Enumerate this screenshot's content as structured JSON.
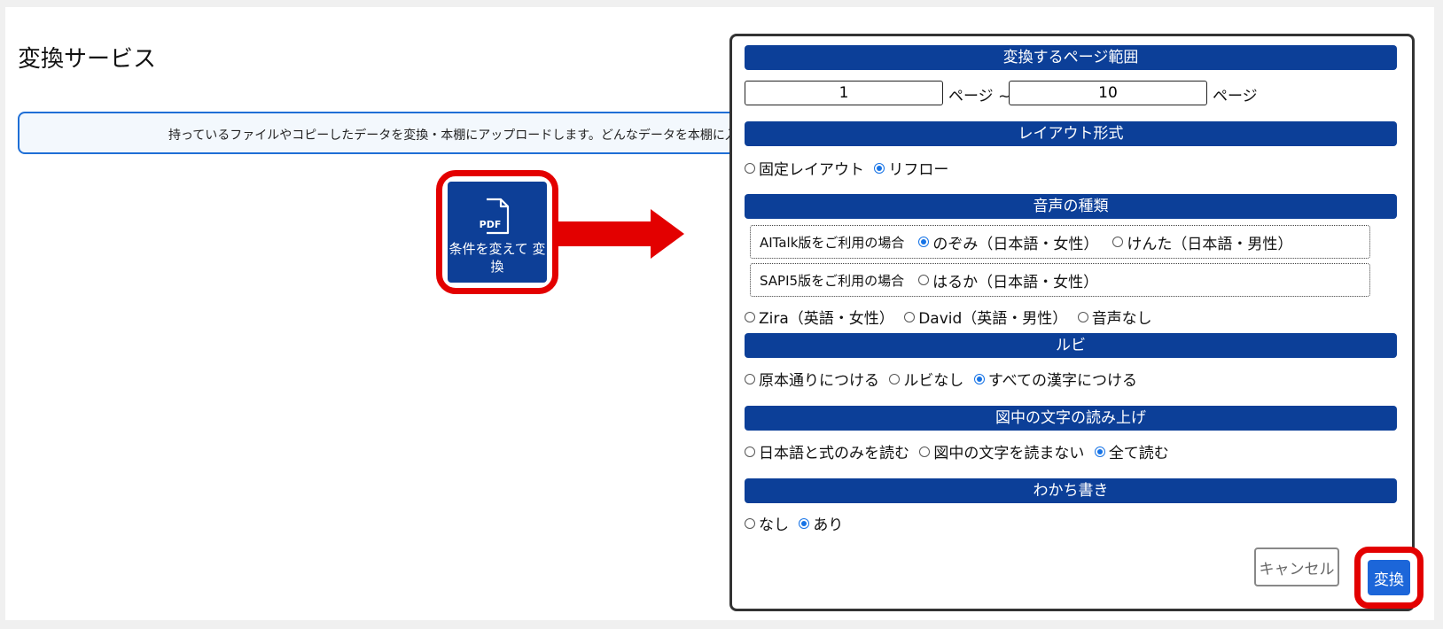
{
  "page": {
    "title": "変換サービス",
    "info_text": "持っているファイルやコピーしたデータを変換・本棚にアップロードします。どんなデータを本棚に入れる"
  },
  "convert_tile": {
    "icon_text": "PDF",
    "label": "条件を変えて 変換"
  },
  "dialog": {
    "page_range": {
      "header": "変換するページ範囲",
      "from_value": "1",
      "to_value": "10",
      "mid_label": "ページ ~",
      "end_label": "ページ"
    },
    "layout": {
      "header": "レイアウト形式",
      "options": [
        {
          "label": "固定レイアウト",
          "selected": false
        },
        {
          "label": "リフロー",
          "selected": true
        }
      ]
    },
    "voice": {
      "header": "音声の種類",
      "aitalk": {
        "prefix": "AITalk版をご利用の場合",
        "options": [
          {
            "label": "のぞみ（日本語・女性）",
            "selected": true
          },
          {
            "label": "けんた（日本語・男性）",
            "selected": false
          }
        ]
      },
      "sapi5": {
        "prefix": "SAPI5版をご利用の場合",
        "options": [
          {
            "label": "はるか（日本語・女性）",
            "selected": false
          }
        ]
      },
      "others": [
        {
          "label": "Zira（英語・女性）",
          "selected": false
        },
        {
          "label": "David（英語・男性）",
          "selected": false
        },
        {
          "label": "音声なし",
          "selected": false
        }
      ]
    },
    "ruby": {
      "header": "ルビ",
      "options": [
        {
          "label": "原本通りにつける",
          "selected": false
        },
        {
          "label": "ルビなし",
          "selected": false
        },
        {
          "label": "すべての漢字につける",
          "selected": true
        }
      ]
    },
    "figure_text": {
      "header": "図中の文字の読み上げ",
      "options": [
        {
          "label": "日本語と式のみを読む",
          "selected": false
        },
        {
          "label": "図中の文字を読まない",
          "selected": false
        },
        {
          "label": "全て読む",
          "selected": true
        }
      ]
    },
    "wakachi": {
      "header": "わかち書き",
      "options": [
        {
          "label": "なし",
          "selected": false
        },
        {
          "label": "あり",
          "selected": true
        }
      ]
    },
    "buttons": {
      "cancel": "キャンセル",
      "submit": "変換"
    }
  },
  "colors": {
    "header_blue": "#0c3f98",
    "tile_blue": "#0d3f97",
    "highlight_red": "#e30000",
    "submit_blue": "#1c66d9",
    "radio_blue": "#1673e6"
  }
}
